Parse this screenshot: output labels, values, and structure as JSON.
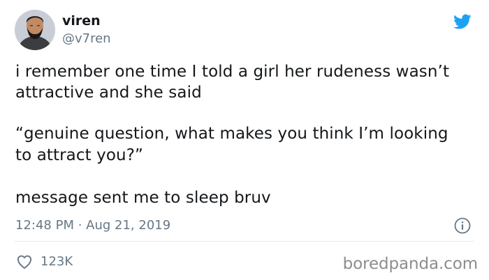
{
  "tweet": {
    "author": {
      "display_name": "viren",
      "handle": "@v7ren",
      "avatar_icon": "profile-photo"
    },
    "platform_icon": "twitter-bird-icon",
    "accent_color": "#1da1f2",
    "text_lines": [
      "i remember one time I told a girl her rudeness wasn’t",
      "attractive and she said",
      "“genuine question, what makes you think I’m looking",
      "to attract you?”",
      "message sent me to sleep bruv"
    ],
    "timestamp": "12:48 PM · Aug 21, 2019",
    "info_icon": "info-icon",
    "like_icon": "heart-icon",
    "like_count": "123K"
  },
  "watermark": {
    "text": "boredpanda.com"
  }
}
